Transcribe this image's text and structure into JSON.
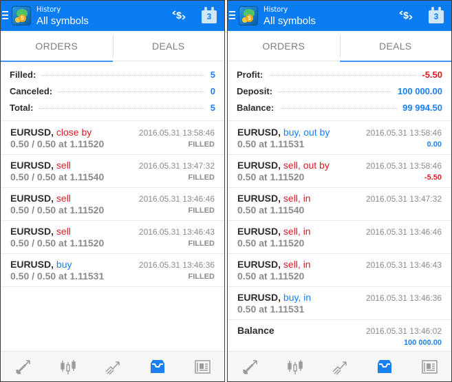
{
  "colors": {
    "appbar": "#0b7cf2",
    "accent_blue": "#1a7ff0",
    "sell_red": "#dd1a22",
    "icon_gray": "#9a9a9a"
  },
  "panels": [
    {
      "appbar": {
        "subtitle": "History",
        "title": "All symbols",
        "calendar_day": "3",
        "icons": [
          "menu-icon",
          "app-logo",
          "exchange-icon",
          "calendar-icon"
        ]
      },
      "tabs": [
        {
          "label": "ORDERS",
          "active": true
        },
        {
          "label": "DEALS",
          "active": false
        }
      ],
      "summary": [
        {
          "label": "Filled:",
          "value": "5",
          "tone": "pos"
        },
        {
          "label": "Canceled:",
          "value": "0",
          "tone": "pos"
        },
        {
          "label": "Total:",
          "value": "5",
          "tone": "pos"
        }
      ],
      "rows": [
        {
          "symbol": "EURUSD,",
          "side": "close by",
          "side_type": "sell",
          "detail": "0.50 / 0.50 at 1.11520",
          "time": "2016.05.31 13:58:46",
          "status": "FILLED",
          "status_tone": "gray"
        },
        {
          "symbol": "EURUSD,",
          "side": "sell",
          "side_type": "sell",
          "detail": "0.50 / 0.50 at 1.11540",
          "time": "2016.05.31 13:47:32",
          "status": "FILLED",
          "status_tone": "gray"
        },
        {
          "symbol": "EURUSD,",
          "side": "sell",
          "side_type": "sell",
          "detail": "0.50 / 0.50 at 1.11520",
          "time": "2016.05.31 13:46:46",
          "status": "FILLED",
          "status_tone": "gray"
        },
        {
          "symbol": "EURUSD,",
          "side": "sell",
          "side_type": "sell",
          "detail": "0.50 / 0.50 at 1.11520",
          "time": "2016.05.31 13:46:43",
          "status": "FILLED",
          "status_tone": "gray"
        },
        {
          "symbol": "EURUSD,",
          "side": "buy",
          "side_type": "buy",
          "detail": "0.50 / 0.50 at 1.11531",
          "time": "2016.05.31 13:46:36",
          "status": "FILLED",
          "status_tone": "gray"
        }
      ],
      "bottom_nav": [
        {
          "name": "quotes",
          "icon": "quotes-arrows-icon",
          "active": false
        },
        {
          "name": "chart",
          "icon": "candlestick-icon",
          "active": false
        },
        {
          "name": "trade",
          "icon": "trade-trend-icon",
          "active": false
        },
        {
          "name": "history",
          "icon": "inbox-history-icon",
          "active": true
        },
        {
          "name": "news",
          "icon": "newspaper-icon",
          "active": false
        }
      ]
    },
    {
      "appbar": {
        "subtitle": "History",
        "title": "All symbols",
        "calendar_day": "3",
        "icons": [
          "menu-icon",
          "app-logo",
          "exchange-icon",
          "calendar-icon"
        ]
      },
      "tabs": [
        {
          "label": "ORDERS",
          "active": false
        },
        {
          "label": "DEALS",
          "active": true
        }
      ],
      "summary": [
        {
          "label": "Profit:",
          "value": "-5.50",
          "tone": "neg"
        },
        {
          "label": "Deposit:",
          "value": "100 000.00",
          "tone": "pos"
        },
        {
          "label": "Balance:",
          "value": "99 994.50",
          "tone": "pos"
        }
      ],
      "rows": [
        {
          "symbol": "EURUSD,",
          "side": "buy, out by",
          "side_type": "buy",
          "detail": "0.50 at 1.11531",
          "time": "2016.05.31 13:58:46",
          "status": "0.00",
          "status_tone": "pos"
        },
        {
          "symbol": "EURUSD,",
          "side": "sell, out by",
          "side_type": "sell",
          "detail": "0.50 at 1.11520",
          "time": "2016.05.31 13:58:46",
          "status": "-5.50",
          "status_tone": "neg"
        },
        {
          "symbol": "EURUSD,",
          "side": "sell, in",
          "side_type": "sell",
          "detail": "0.50 at 1.11540",
          "time": "2016.05.31 13:47:32",
          "status": "",
          "status_tone": "gray"
        },
        {
          "symbol": "EURUSD,",
          "side": "sell, in",
          "side_type": "sell",
          "detail": "0.50 at 1.11520",
          "time": "2016.05.31 13:46:46",
          "status": "",
          "status_tone": "gray"
        },
        {
          "symbol": "EURUSD,",
          "side": "sell, in",
          "side_type": "sell",
          "detail": "0.50 at 1.11520",
          "time": "2016.05.31 13:46:43",
          "status": "",
          "status_tone": "gray"
        },
        {
          "symbol": "EURUSD,",
          "side": "buy, in",
          "side_type": "buy",
          "detail": "0.50 at 1.11531",
          "time": "2016.05.31 13:46:36",
          "status": "",
          "status_tone": "gray"
        },
        {
          "symbol": "Balance",
          "side": "",
          "side_type": "none",
          "detail": "",
          "time": "2016.05.31 13:46:02",
          "status": "100 000.00",
          "status_tone": "pos"
        }
      ],
      "bottom_nav": [
        {
          "name": "quotes",
          "icon": "quotes-arrows-icon",
          "active": false
        },
        {
          "name": "chart",
          "icon": "candlestick-icon",
          "active": false
        },
        {
          "name": "trade",
          "icon": "trade-trend-icon",
          "active": false
        },
        {
          "name": "history",
          "icon": "inbox-history-icon",
          "active": true
        },
        {
          "name": "news",
          "icon": "newspaper-icon",
          "active": false
        }
      ]
    }
  ]
}
